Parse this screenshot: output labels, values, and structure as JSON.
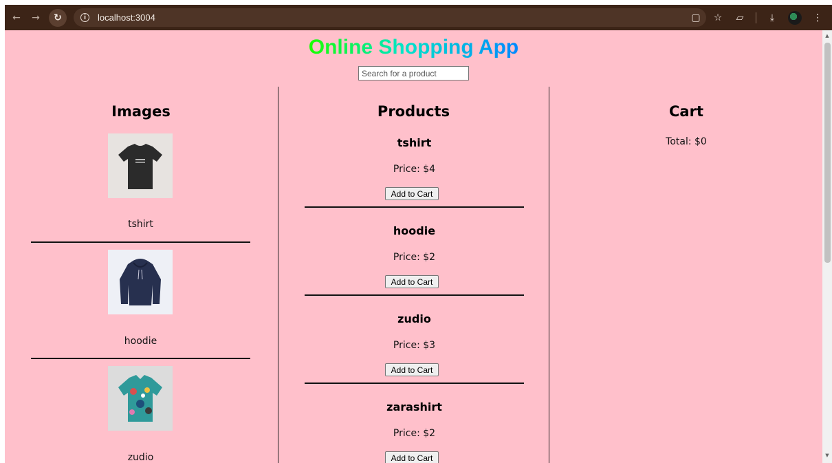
{
  "browser": {
    "url": "localhost:3004",
    "back_icon": "arrow-left-icon",
    "forward_icon": "arrow-right-icon",
    "reload_icon": "reload-icon",
    "info_icon": "info-icon"
  },
  "page": {
    "title": "Online Shopping App",
    "search_placeholder": "Search for a product",
    "background": "#ffc0cb"
  },
  "images": {
    "heading": "Images",
    "items": [
      {
        "label": "tshirt",
        "icon": "tshirt-image"
      },
      {
        "label": "hoodie",
        "icon": "hoodie-image"
      },
      {
        "label": "zudio",
        "icon": "printed-shirt-image"
      }
    ]
  },
  "products": {
    "heading": "Products",
    "items": [
      {
        "name": "tshirt",
        "price": "Price: $4",
        "button": "Add to Cart"
      },
      {
        "name": "hoodie",
        "price": "Price: $2",
        "button": "Add to Cart"
      },
      {
        "name": "zudio",
        "price": "Price: $3",
        "button": "Add to Cart"
      },
      {
        "name": "zarashirt",
        "price": "Price: $2",
        "button": "Add to Cart"
      }
    ]
  },
  "cart": {
    "heading": "Cart",
    "total": "Total: $0"
  }
}
